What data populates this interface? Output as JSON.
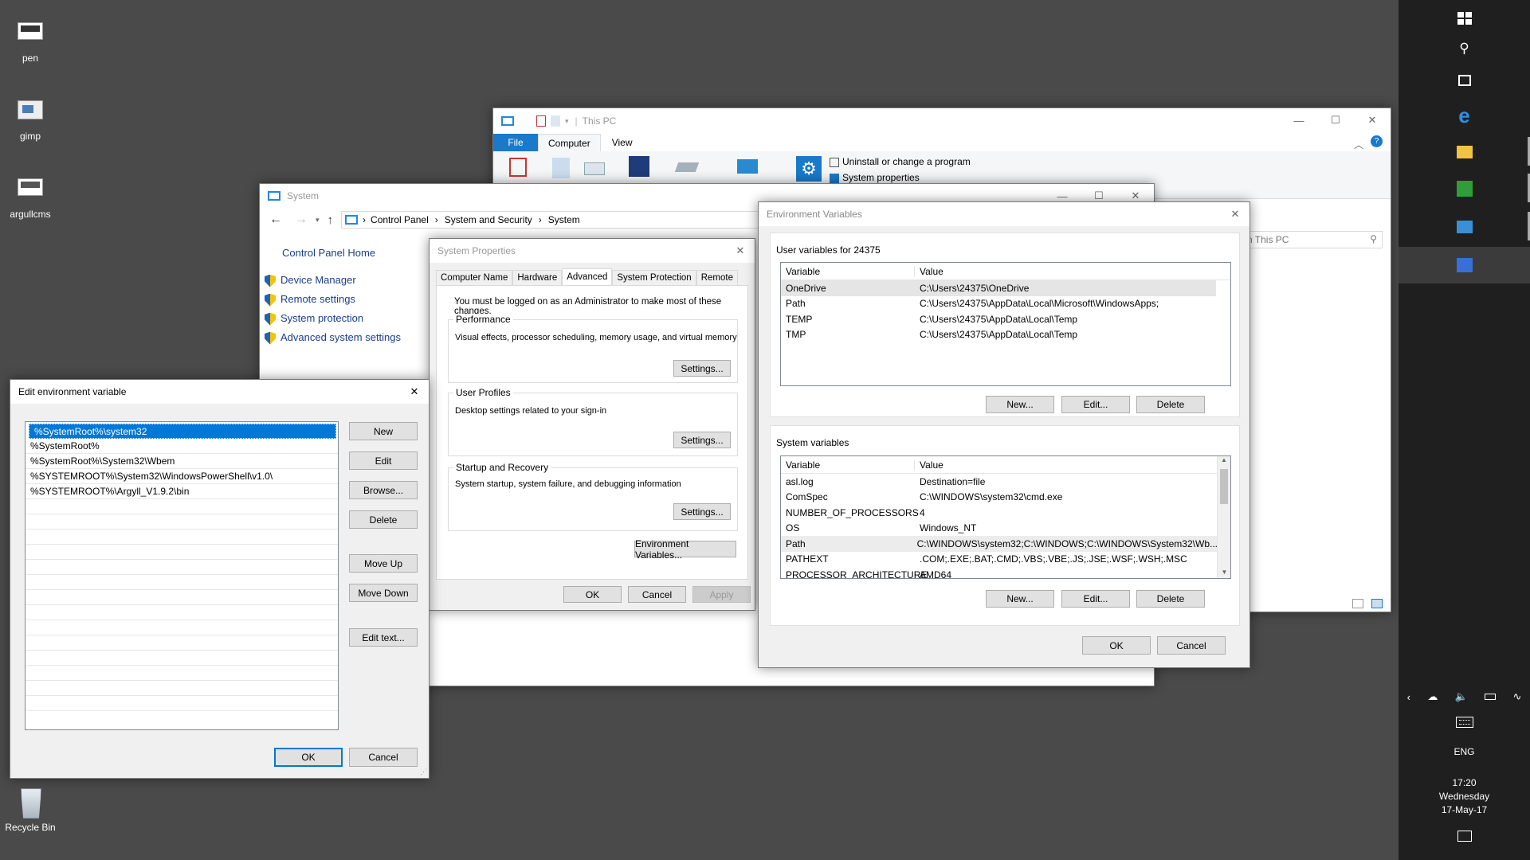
{
  "desktop": {
    "icons": [
      {
        "label": "pen"
      },
      {
        "label": "gimp"
      },
      {
        "label": "argullcms"
      },
      {
        "label": "Recycle Bin"
      }
    ]
  },
  "explorer": {
    "title": "This PC",
    "tabs": [
      "File",
      "Computer",
      "View"
    ],
    "ribbon_items": [
      "Uninstall or change a program",
      "System properties"
    ],
    "search_placeholder": "h This PC"
  },
  "system_window": {
    "title": "System",
    "breadcrumb": [
      "Control Panel",
      "System and Security",
      "System"
    ],
    "home_link": "Control Panel Home",
    "links": [
      "Device Manager",
      "Remote settings",
      "System protection",
      "Advanced system settings"
    ]
  },
  "system_properties": {
    "title": "System Properties",
    "tabs": [
      "Computer Name",
      "Hardware",
      "Advanced",
      "System Protection",
      "Remote"
    ],
    "admin_note": "You must be logged on as an Administrator to make most of these changes.",
    "performance": {
      "label": "Performance",
      "desc": "Visual effects, processor scheduling, memory usage, and virtual memory",
      "button": "Settings..."
    },
    "user_profiles": {
      "label": "User Profiles",
      "desc": "Desktop settings related to your sign-in",
      "button": "Settings..."
    },
    "startup": {
      "label": "Startup and Recovery",
      "desc": "System startup, system failure, and debugging information",
      "button": "Settings..."
    },
    "env_button": "Environment Variables...",
    "ok": "OK",
    "cancel": "Cancel",
    "apply": "Apply"
  },
  "env_vars": {
    "title": "Environment Variables",
    "user_label": "User variables for 24375",
    "col_variable": "Variable",
    "col_value": "Value",
    "user_rows": [
      {
        "name": "OneDrive",
        "value": "C:\\Users\\24375\\OneDrive"
      },
      {
        "name": "Path",
        "value": "C:\\Users\\24375\\AppData\\Local\\Microsoft\\WindowsApps;"
      },
      {
        "name": "TEMP",
        "value": "C:\\Users\\24375\\AppData\\Local\\Temp"
      },
      {
        "name": "TMP",
        "value": "C:\\Users\\24375\\AppData\\Local\\Temp"
      }
    ],
    "system_label": "System variables",
    "system_rows": [
      {
        "name": "asl.log",
        "value": "Destination=file"
      },
      {
        "name": "ComSpec",
        "value": "C:\\WINDOWS\\system32\\cmd.exe"
      },
      {
        "name": "NUMBER_OF_PROCESSORS",
        "value": "4"
      },
      {
        "name": "OS",
        "value": "Windows_NT"
      },
      {
        "name": "Path",
        "value": "C:\\WINDOWS\\system32;C:\\WINDOWS;C:\\WINDOWS\\System32\\Wb..."
      },
      {
        "name": "PATHEXT",
        "value": ".COM;.EXE;.BAT;.CMD;.VBS;.VBE;.JS;.JSE;.WSF;.WSH;.MSC"
      },
      {
        "name": "PROCESSOR_ARCHITECTURE",
        "value": "AMD64"
      }
    ],
    "new": "New...",
    "edit": "Edit...",
    "delete": "Delete",
    "ok": "OK",
    "cancel": "Cancel"
  },
  "edit_env": {
    "title": "Edit environment variable",
    "entries": [
      "%SystemRoot%\\system32",
      "%SystemRoot%",
      "%SystemRoot%\\System32\\Wbem",
      "%SYSTEMROOT%\\System32\\WindowsPowerShell\\v1.0\\",
      "%SYSTEMROOT%\\Argyll_V1.9.2\\bin"
    ],
    "buttons": [
      "New",
      "Edit",
      "Browse...",
      "Delete",
      "Move Up",
      "Move Down",
      "Edit text..."
    ],
    "ok": "OK",
    "cancel": "Cancel"
  },
  "taskbar": {
    "language": "ENG",
    "time": "17:20",
    "day": "Wednesday",
    "date": "17-May-17"
  },
  "colors": {
    "accent": "#0078d7",
    "desktop": "#4a4a4a",
    "taskbar": "#1f1f1f"
  }
}
